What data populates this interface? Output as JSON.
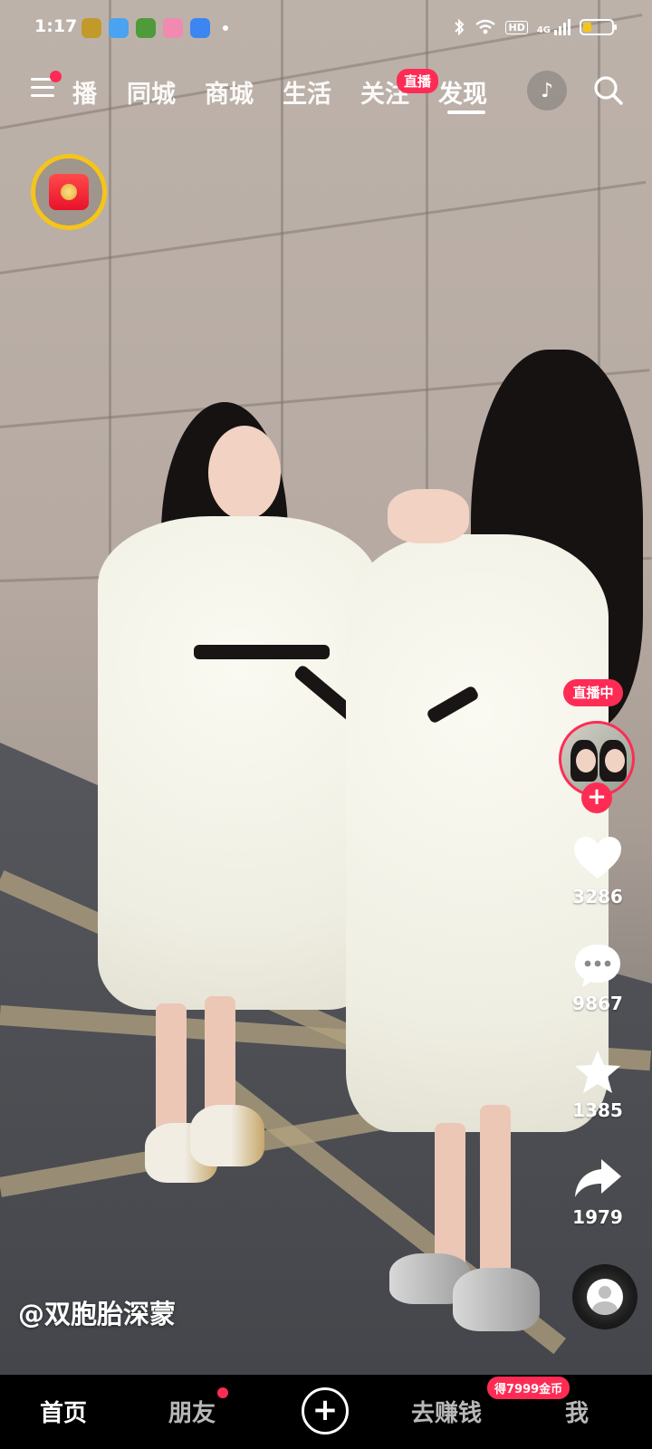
{
  "status_bar": {
    "time": "1:17",
    "network": "HD",
    "signal": "4G",
    "battery_level": 0.3,
    "icons": [
      "bluetooth-icon",
      "wifi-icon",
      "hd-icon",
      "signal-icon",
      "battery-icon"
    ]
  },
  "top_nav": {
    "tabs": [
      {
        "label": "播"
      },
      {
        "label": "同城"
      },
      {
        "label": "商城"
      },
      {
        "label": "生活"
      },
      {
        "label": "关注"
      },
      {
        "label": "发现"
      }
    ],
    "active_tab": "发现",
    "live_badge": "直播",
    "tiktok_glyph": "♪",
    "menu_has_notification": true
  },
  "right_rail": {
    "live_tag": "直播中",
    "follow": "+",
    "likes": "3286",
    "comments": "9867",
    "favorites": "1385",
    "shares": "1979"
  },
  "video": {
    "author": "@双胞胎深蒙"
  },
  "bottom_nav": {
    "home": "首页",
    "friends": "朋友",
    "create": "+",
    "earn": "去赚钱",
    "earn_badge": "得7999金币",
    "me": "我"
  },
  "colors": {
    "accent": "#fe2c55",
    "battery": "#f5c518",
    "ring": "#f5c518"
  }
}
